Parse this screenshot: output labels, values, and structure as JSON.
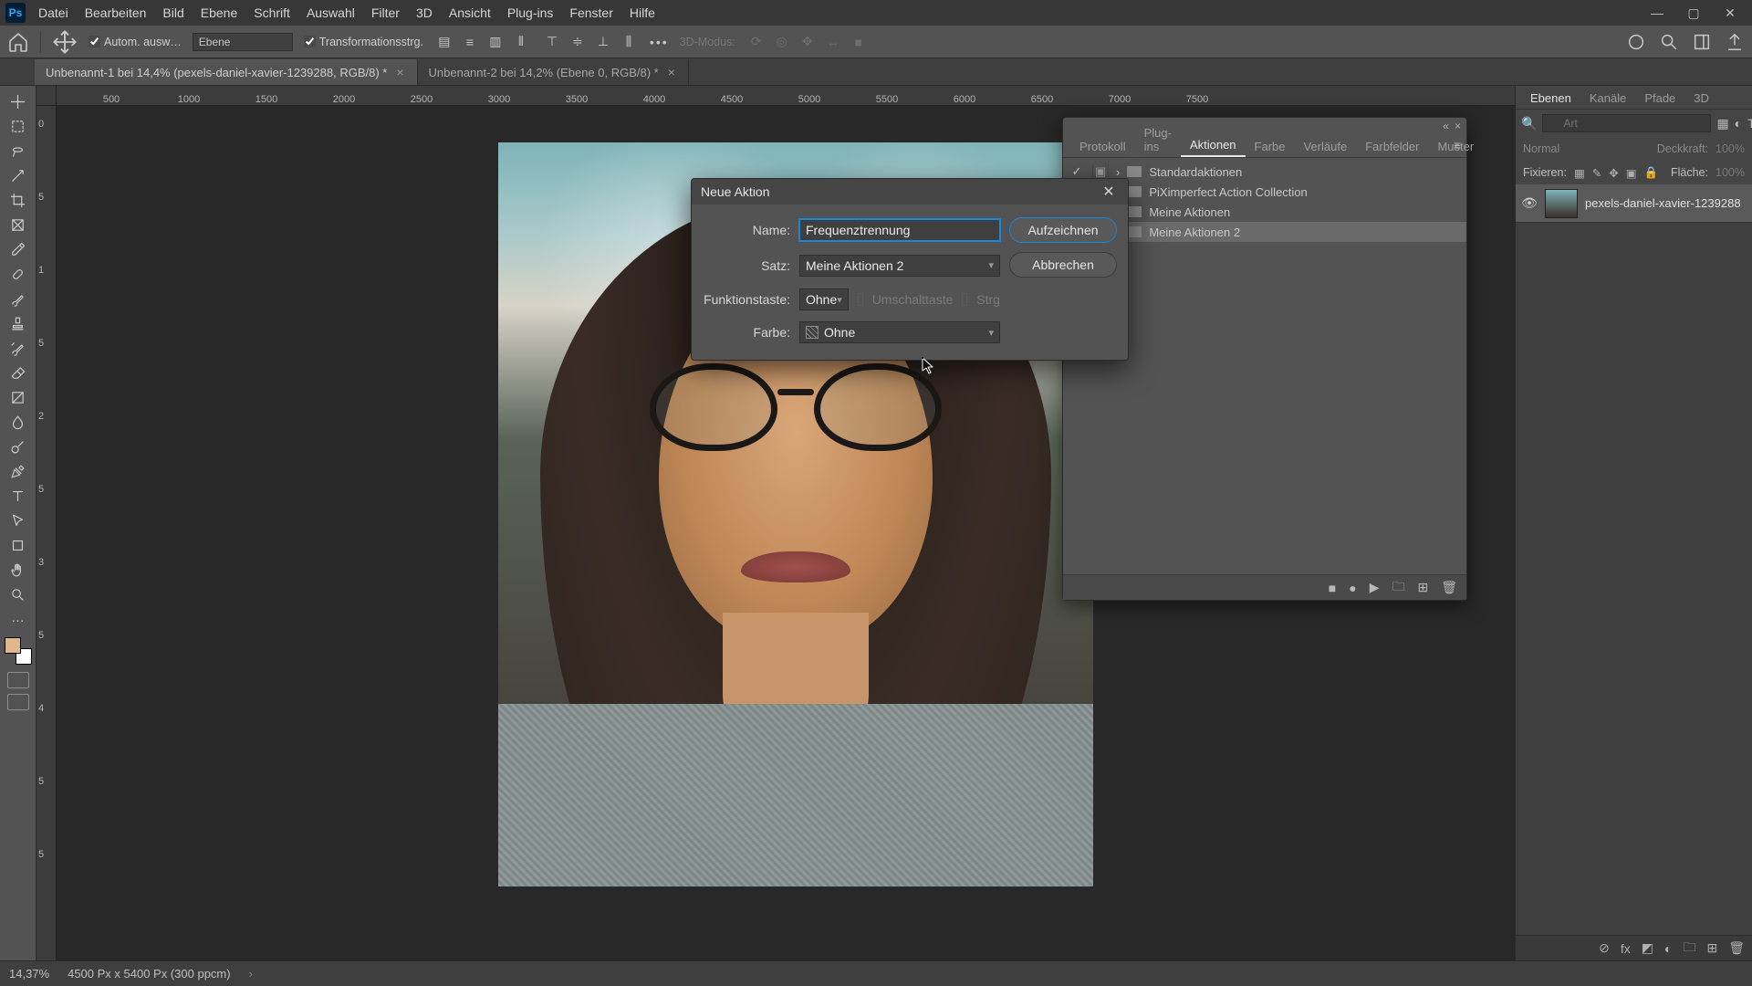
{
  "menu": {
    "items": [
      "Datei",
      "Bearbeiten",
      "Bild",
      "Ebene",
      "Schrift",
      "Auswahl",
      "Filter",
      "3D",
      "Ansicht",
      "Plug-ins",
      "Fenster",
      "Hilfe"
    ]
  },
  "optionsbar": {
    "autoSelectLabel": "Autom. ausw…",
    "layerDropdown": "Ebene",
    "transformCtrls": "Transformationsstrg.",
    "threeDMode": "3D-Modus:"
  },
  "docTabs": [
    {
      "label": "Unbenannt-1 bei 14,4% (pexels-daniel-xavier-1239288, RGB/8) *"
    },
    {
      "label": "Unbenannt-2 bei 14,2% (Ebene 0, RGB/8) *"
    }
  ],
  "rulerH": [
    "500",
    "1000",
    "1500",
    "2000",
    "2500",
    "3000",
    "3500",
    "4000",
    "4500",
    "5000",
    "5500",
    "6000",
    "6500",
    "7000",
    "7500"
  ],
  "rulerV": [
    "0",
    "5",
    "1",
    "5",
    "2",
    "5",
    "3",
    "5",
    "4",
    "5",
    "5"
  ],
  "actionsPanel": {
    "tabs": [
      "Protokoll",
      "Plug-ins",
      "Aktionen",
      "Farbe",
      "Verläufe",
      "Farbfelder",
      "Muster"
    ],
    "activeTab": "Aktionen",
    "rows": [
      {
        "vis": "✓",
        "mod": "▣",
        "toggle": "›",
        "folder": true,
        "label": "Standardaktionen"
      },
      {
        "vis": "",
        "mod": "",
        "toggle": "›",
        "folder": true,
        "label": "PiXimperfect Action Collection"
      },
      {
        "vis": "",
        "mod": "",
        "toggle": "›",
        "folder": true,
        "label": "Meine Aktionen"
      },
      {
        "vis": "",
        "mod": "",
        "toggle": "›",
        "folder": true,
        "label": "Meine Aktionen 2",
        "selected": true
      }
    ]
  },
  "dialog": {
    "title": "Neue Aktion",
    "labels": {
      "name": "Name:",
      "set": "Satz:",
      "fkey": "Funktionstaste:",
      "color": "Farbe:"
    },
    "name": "Frequenztrennung",
    "set": "Meine Aktionen 2",
    "fkey": "Ohne",
    "shift": "Umschalttaste",
    "ctrl": "Strg",
    "color": "Ohne",
    "recordBtn": "Aufzeichnen",
    "cancelBtn": "Abbrechen"
  },
  "layersPanel": {
    "tabs": [
      "Ebenen",
      "Kanäle",
      "Pfade",
      "3D"
    ],
    "activeTab": "Ebenen",
    "searchPlaceholder": "Art",
    "blendLabel": "Normal",
    "opacityLabel": "Deckkraft:",
    "opacityVal": "100%",
    "lockLabel": "Fixieren:",
    "fillLabel": "Fläche:",
    "fillVal": "100%",
    "layerName": "pexels-daniel-xavier-1239288"
  },
  "status": {
    "zoom": "14,37%",
    "docinfo": "4500 Px x 5400 Px (300 ppcm)"
  }
}
